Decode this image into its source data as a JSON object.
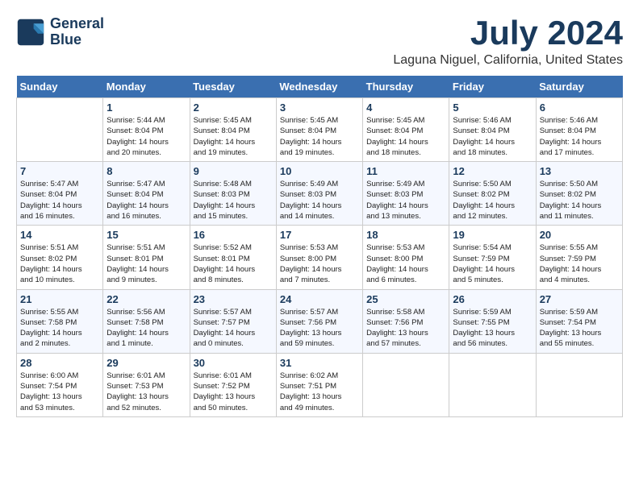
{
  "header": {
    "logo_line1": "General",
    "logo_line2": "Blue",
    "month": "July 2024",
    "location": "Laguna Niguel, California, United States"
  },
  "weekdays": [
    "Sunday",
    "Monday",
    "Tuesday",
    "Wednesday",
    "Thursday",
    "Friday",
    "Saturday"
  ],
  "weeks": [
    [
      {
        "num": "",
        "detail": ""
      },
      {
        "num": "1",
        "detail": "Sunrise: 5:44 AM\nSunset: 8:04 PM\nDaylight: 14 hours\nand 20 minutes."
      },
      {
        "num": "2",
        "detail": "Sunrise: 5:45 AM\nSunset: 8:04 PM\nDaylight: 14 hours\nand 19 minutes."
      },
      {
        "num": "3",
        "detail": "Sunrise: 5:45 AM\nSunset: 8:04 PM\nDaylight: 14 hours\nand 19 minutes."
      },
      {
        "num": "4",
        "detail": "Sunrise: 5:45 AM\nSunset: 8:04 PM\nDaylight: 14 hours\nand 18 minutes."
      },
      {
        "num": "5",
        "detail": "Sunrise: 5:46 AM\nSunset: 8:04 PM\nDaylight: 14 hours\nand 18 minutes."
      },
      {
        "num": "6",
        "detail": "Sunrise: 5:46 AM\nSunset: 8:04 PM\nDaylight: 14 hours\nand 17 minutes."
      }
    ],
    [
      {
        "num": "7",
        "detail": "Sunrise: 5:47 AM\nSunset: 8:04 PM\nDaylight: 14 hours\nand 16 minutes."
      },
      {
        "num": "8",
        "detail": "Sunrise: 5:47 AM\nSunset: 8:04 PM\nDaylight: 14 hours\nand 16 minutes."
      },
      {
        "num": "9",
        "detail": "Sunrise: 5:48 AM\nSunset: 8:03 PM\nDaylight: 14 hours\nand 15 minutes."
      },
      {
        "num": "10",
        "detail": "Sunrise: 5:49 AM\nSunset: 8:03 PM\nDaylight: 14 hours\nand 14 minutes."
      },
      {
        "num": "11",
        "detail": "Sunrise: 5:49 AM\nSunset: 8:03 PM\nDaylight: 14 hours\nand 13 minutes."
      },
      {
        "num": "12",
        "detail": "Sunrise: 5:50 AM\nSunset: 8:02 PM\nDaylight: 14 hours\nand 12 minutes."
      },
      {
        "num": "13",
        "detail": "Sunrise: 5:50 AM\nSunset: 8:02 PM\nDaylight: 14 hours\nand 11 minutes."
      }
    ],
    [
      {
        "num": "14",
        "detail": "Sunrise: 5:51 AM\nSunset: 8:02 PM\nDaylight: 14 hours\nand 10 minutes."
      },
      {
        "num": "15",
        "detail": "Sunrise: 5:51 AM\nSunset: 8:01 PM\nDaylight: 14 hours\nand 9 minutes."
      },
      {
        "num": "16",
        "detail": "Sunrise: 5:52 AM\nSunset: 8:01 PM\nDaylight: 14 hours\nand 8 minutes."
      },
      {
        "num": "17",
        "detail": "Sunrise: 5:53 AM\nSunset: 8:00 PM\nDaylight: 14 hours\nand 7 minutes."
      },
      {
        "num": "18",
        "detail": "Sunrise: 5:53 AM\nSunset: 8:00 PM\nDaylight: 14 hours\nand 6 minutes."
      },
      {
        "num": "19",
        "detail": "Sunrise: 5:54 AM\nSunset: 7:59 PM\nDaylight: 14 hours\nand 5 minutes."
      },
      {
        "num": "20",
        "detail": "Sunrise: 5:55 AM\nSunset: 7:59 PM\nDaylight: 14 hours\nand 4 minutes."
      }
    ],
    [
      {
        "num": "21",
        "detail": "Sunrise: 5:55 AM\nSunset: 7:58 PM\nDaylight: 14 hours\nand 2 minutes."
      },
      {
        "num": "22",
        "detail": "Sunrise: 5:56 AM\nSunset: 7:58 PM\nDaylight: 14 hours\nand 1 minute."
      },
      {
        "num": "23",
        "detail": "Sunrise: 5:57 AM\nSunset: 7:57 PM\nDaylight: 14 hours\nand 0 minutes."
      },
      {
        "num": "24",
        "detail": "Sunrise: 5:57 AM\nSunset: 7:56 PM\nDaylight: 13 hours\nand 59 minutes."
      },
      {
        "num": "25",
        "detail": "Sunrise: 5:58 AM\nSunset: 7:56 PM\nDaylight: 13 hours\nand 57 minutes."
      },
      {
        "num": "26",
        "detail": "Sunrise: 5:59 AM\nSunset: 7:55 PM\nDaylight: 13 hours\nand 56 minutes."
      },
      {
        "num": "27",
        "detail": "Sunrise: 5:59 AM\nSunset: 7:54 PM\nDaylight: 13 hours\nand 55 minutes."
      }
    ],
    [
      {
        "num": "28",
        "detail": "Sunrise: 6:00 AM\nSunset: 7:54 PM\nDaylight: 13 hours\nand 53 minutes."
      },
      {
        "num": "29",
        "detail": "Sunrise: 6:01 AM\nSunset: 7:53 PM\nDaylight: 13 hours\nand 52 minutes."
      },
      {
        "num": "30",
        "detail": "Sunrise: 6:01 AM\nSunset: 7:52 PM\nDaylight: 13 hours\nand 50 minutes."
      },
      {
        "num": "31",
        "detail": "Sunrise: 6:02 AM\nSunset: 7:51 PM\nDaylight: 13 hours\nand 49 minutes."
      },
      {
        "num": "",
        "detail": ""
      },
      {
        "num": "",
        "detail": ""
      },
      {
        "num": "",
        "detail": ""
      }
    ]
  ]
}
